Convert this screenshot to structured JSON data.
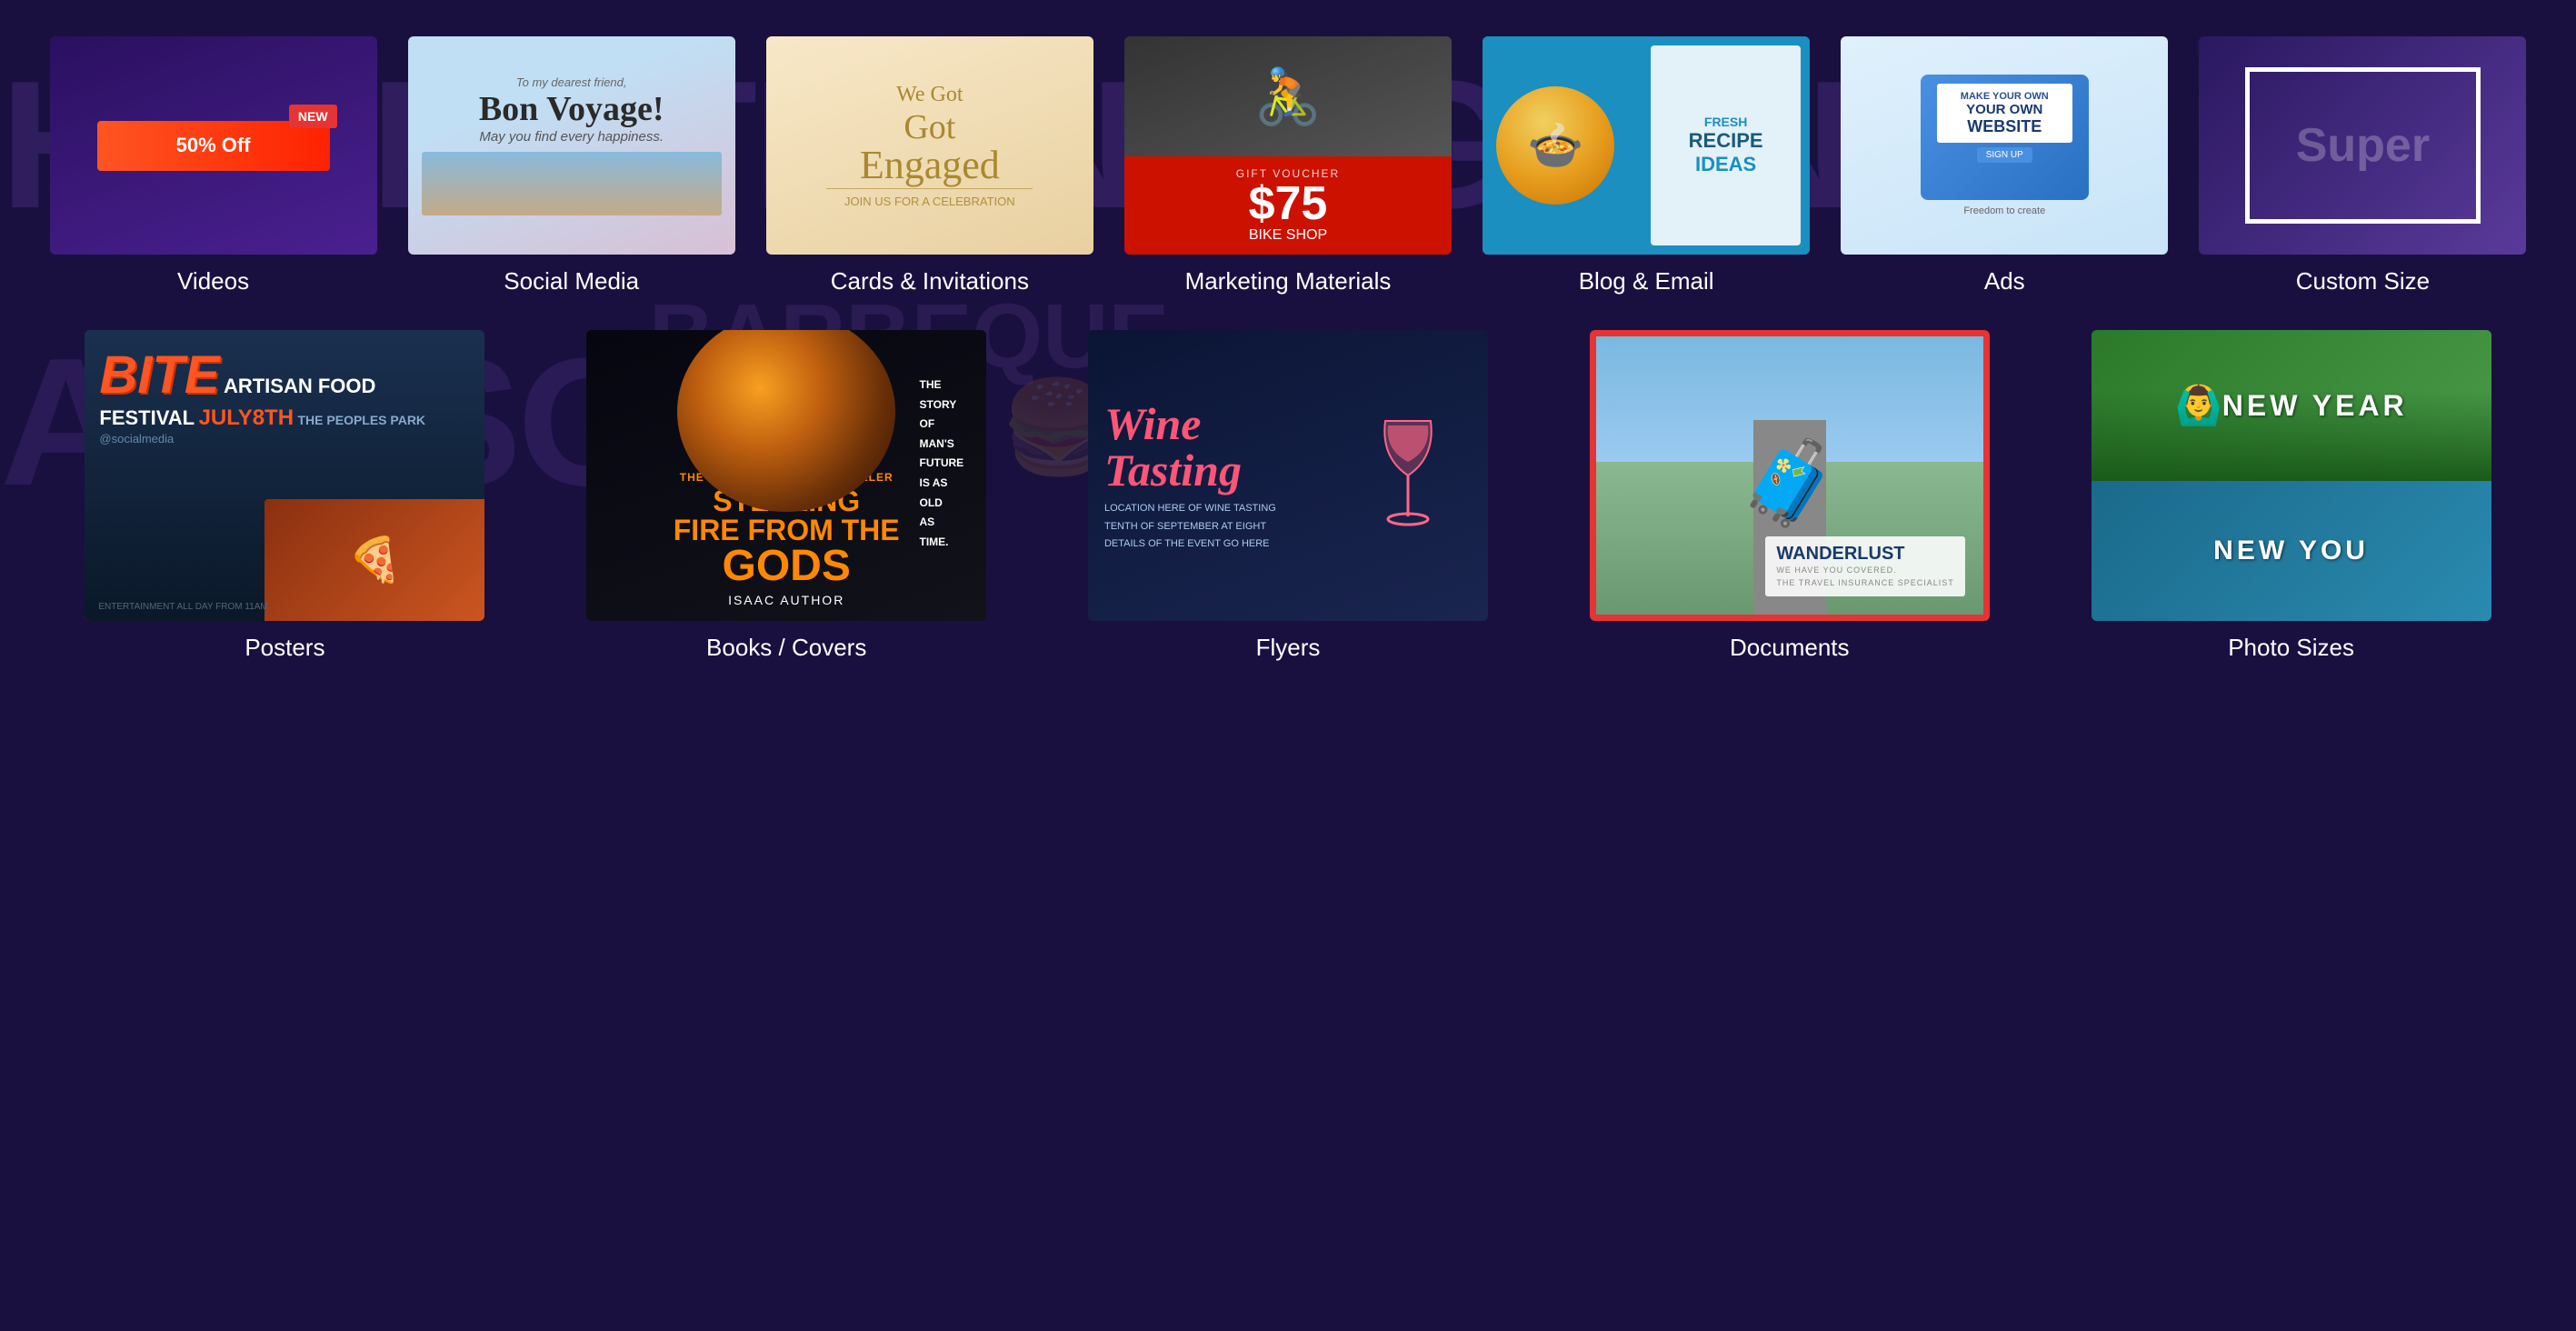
{
  "page": {
    "bg_color": "#1a1040"
  },
  "top_row": {
    "items": [
      {
        "id": "videos",
        "label": "Videos",
        "thumb_type": "videos",
        "new_badge": "NEW",
        "discount": "50% Off"
      },
      {
        "id": "social-media",
        "label": "Social Media",
        "thumb_type": "social",
        "greeting": "To my dearest friend,",
        "title": "Bon Voyage!",
        "subtitle": "May you find every happiness."
      },
      {
        "id": "cards",
        "label": "Cards & Invitations",
        "thumb_type": "cards",
        "line1": "We Got",
        "line2": "Engaged",
        "sub": "JOIN US FOR A CELEBRATION"
      },
      {
        "id": "marketing",
        "label": "Marketing Materials",
        "thumb_type": "marketing",
        "gift": "GIFT VOUCHER",
        "price": "$75",
        "shop": "BIKE SHOP"
      },
      {
        "id": "blog-email",
        "label": "Blog & Email",
        "thumb_type": "blog",
        "fresh": "FRESH",
        "recipe": "RECIPE",
        "ideas": "IDEAS"
      },
      {
        "id": "ads",
        "label": "Ads",
        "thumb_type": "ads",
        "make": "MAKE YOUR OWN",
        "website": "WEBSITE",
        "signup": "SIGN UP",
        "tagline": "Freedom to create"
      },
      {
        "id": "custom-size",
        "label": "Custom Size",
        "thumb_type": "custom",
        "preview_text": "Super"
      }
    ]
  },
  "bottom_row": {
    "items": [
      {
        "id": "posters",
        "label": "Posters",
        "thumb_type": "posters",
        "bite": "BITE",
        "artisan": "ARTISAN FOOD FESTIVAL",
        "july": "JULY8TH",
        "park": "THE PEOPLES PARK",
        "social": "@socialmedia",
        "ent": "ENTERTAINMENT ALL DAY FROM 11AM"
      },
      {
        "id": "books-covers",
        "label": "Books / Covers",
        "thumb_type": "books",
        "bestseller": "THE INTERNATIONAL BESTSELLER",
        "stealing": "STEALING",
        "fire": "FIRE FROM THE",
        "gods": "GODS",
        "author": "ISAAC AUTHOR",
        "story_lines": [
          "THE",
          "STORY",
          "OF",
          "MAN'S",
          "FUTURE",
          "IS AS",
          "OLD",
          "AS",
          "TIME."
        ]
      },
      {
        "id": "flyers",
        "label": "Flyers",
        "thumb_type": "flyers",
        "wine": "Wine",
        "tasting": "Tasting",
        "detail1": "LOCATION HERE OF WINE TASTING",
        "detail2": "TENTH OF SEPTEMBER AT EIGHT",
        "detail3": "DETAILS OF THE EVENT GO HERE"
      },
      {
        "id": "documents",
        "label": "Documents",
        "thumb_type": "documents",
        "selected": true,
        "wanderlust": "WANDERLUST",
        "sub1": "WE HAVE YOU COVERED.",
        "sub2": "THE TRAVEL INSURANCE SPECIALIST"
      },
      {
        "id": "photo-sizes",
        "label": "Photo Sizes",
        "thumb_type": "photos",
        "newyear": "NEW YEAR",
        "newyou": "NEW YOU"
      }
    ]
  },
  "bg_decorative": {
    "top_text": "HAPPY THANKSGIVING",
    "bottom_text": "AWESOME",
    "bbq_text": "BARBEQUE GRILL"
  }
}
